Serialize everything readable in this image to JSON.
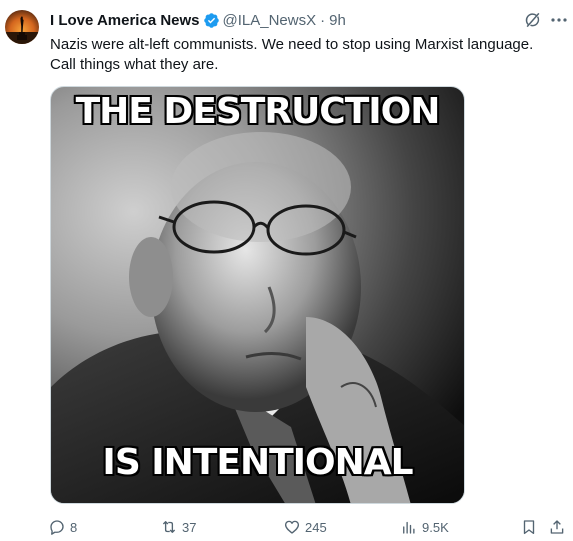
{
  "tweet": {
    "author_name": "I Love America News",
    "handle": "@ILA_NewsX",
    "separator": "·",
    "time": "9h",
    "text": "Nazis were alt-left communists. We need to stop using Marxist language.\nCall things what they are."
  },
  "media": {
    "top_caption": "THE DESTRUCTION",
    "bottom_caption": "IS INTENTIONAL"
  },
  "actions": {
    "reply_count": "8",
    "retweet_count": "37",
    "like_count": "245",
    "views_count": "9.5K"
  },
  "colors": {
    "verified": "#1d9bf0",
    "secondary_text": "#536471",
    "primary_text": "#0f1419"
  }
}
